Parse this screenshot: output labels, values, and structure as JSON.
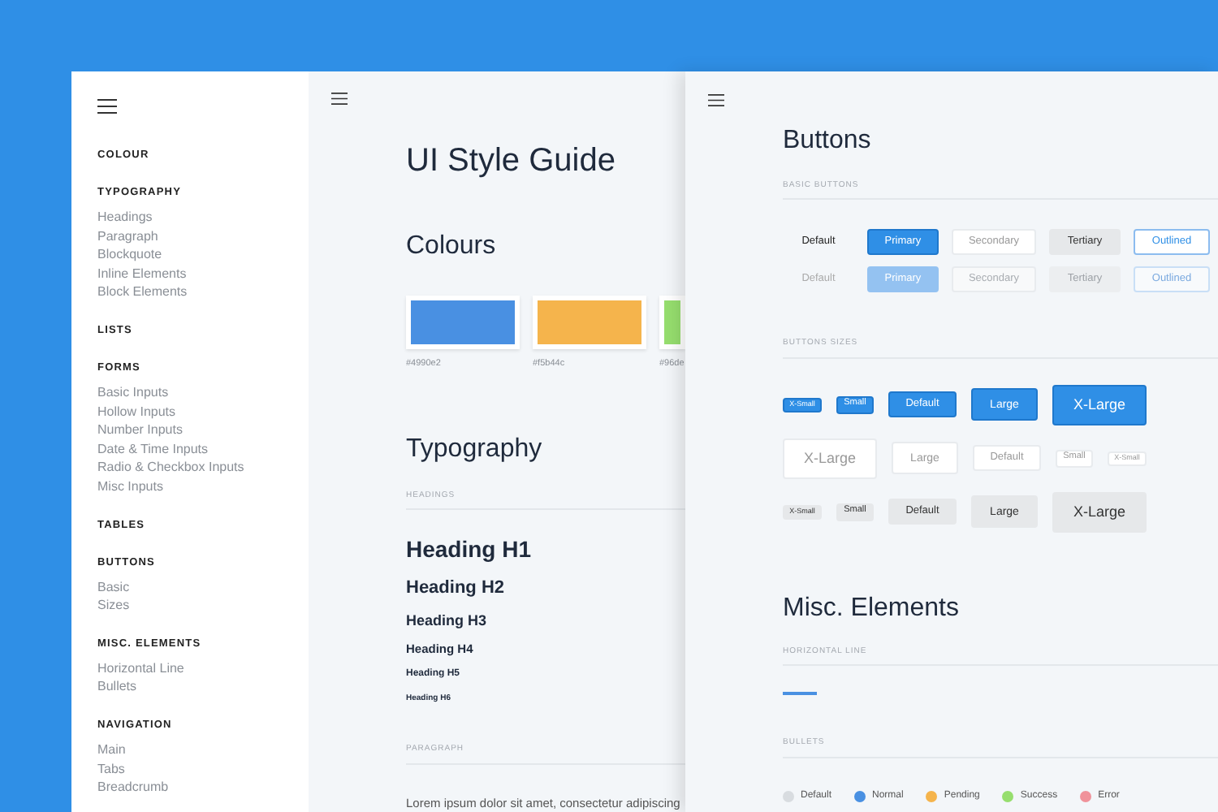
{
  "sidebar": {
    "sections": [
      {
        "title": "COLOUR"
      },
      {
        "title": "TYPOGRAPHY",
        "items": [
          "Headings",
          "Paragraph",
          "Blockquote",
          "Inline Elements",
          "Block Elements"
        ]
      },
      {
        "title": "LISTS"
      },
      {
        "title": "FORMS",
        "items": [
          "Basic Inputs",
          "Hollow Inputs",
          "Number Inputs",
          "Date & Time Inputs",
          "Radio & Checkbox Inputs",
          "Misc Inputs"
        ]
      },
      {
        "title": "TABLES"
      },
      {
        "title": "BUTTONS",
        "items": [
          "Basic",
          "Sizes"
        ]
      },
      {
        "title": "MISC. ELEMENTS",
        "items": [
          "Horizontal Line",
          "Bullets"
        ]
      },
      {
        "title": "NAVIGATION",
        "items": [
          "Main",
          "Tabs",
          "Breadcrumb"
        ]
      }
    ]
  },
  "guide": {
    "title": "UI Style Guide",
    "colours": {
      "heading": "Colours",
      "swatches": [
        {
          "color": "#4990e2",
          "label": "#4990e2"
        },
        {
          "color": "#f5b44c",
          "label": "#f5b44c"
        },
        {
          "color": "#96de6e",
          "label": "#96de"
        }
      ]
    },
    "typography": {
      "heading": "Typography",
      "headings_label": "HEADINGS",
      "headings": [
        {
          "kind": "h1",
          "text": "Heading H1"
        },
        {
          "kind": "h2",
          "text": "Heading H2"
        },
        {
          "kind": "h3",
          "text": "Heading H3"
        },
        {
          "kind": "h4",
          "text": "Heading H4"
        },
        {
          "kind": "h5",
          "text": "Heading H5"
        },
        {
          "kind": "h6",
          "text": "Heading H6"
        }
      ],
      "paragraph_label": "PARAGRAPH",
      "paragraph": "Lorem ipsum dolor sit amet, consectetur adipiscing"
    }
  },
  "buttons_page": {
    "title": "Buttons",
    "basic_label": "BASIC BUTTONS",
    "basic_rows": [
      {
        "disabled": false,
        "buttons": [
          {
            "kind": "default",
            "label": "Default"
          },
          {
            "kind": "primary",
            "label": "Primary"
          },
          {
            "kind": "secondary",
            "label": "Secondary"
          },
          {
            "kind": "tertiary",
            "label": "Tertiary"
          },
          {
            "kind": "outlined",
            "label": "Outlined"
          }
        ]
      },
      {
        "disabled": true,
        "buttons": [
          {
            "kind": "default",
            "label": "Default"
          },
          {
            "kind": "primary",
            "label": "Primary"
          },
          {
            "kind": "secondary",
            "label": "Secondary"
          },
          {
            "kind": "tertiary",
            "label": "Tertiary"
          },
          {
            "kind": "outlined",
            "label": "Outlined"
          }
        ]
      }
    ],
    "sizes_label": "BUTTONS SIZES",
    "size_rows": [
      {
        "kind": "primary",
        "buttons": [
          {
            "kind": "xs",
            "label": "X-Small"
          },
          {
            "kind": "s",
            "label": "Small"
          },
          {
            "kind": "m",
            "label": "Default"
          },
          {
            "kind": "l",
            "label": "Large"
          },
          {
            "kind": "xl",
            "label": "X-Large"
          }
        ]
      },
      {
        "kind": "secondary",
        "buttons": [
          {
            "kind": "xl",
            "label": "X-Large"
          },
          {
            "kind": "l",
            "label": "Large"
          },
          {
            "kind": "m",
            "label": "Default"
          },
          {
            "kind": "s",
            "label": "Small"
          },
          {
            "kind": "xs",
            "label": "X-Small"
          }
        ]
      },
      {
        "kind": "tertiary",
        "buttons": [
          {
            "kind": "xs",
            "label": "X-Small"
          },
          {
            "kind": "s",
            "label": "Small"
          },
          {
            "kind": "m",
            "label": "Default"
          },
          {
            "kind": "l",
            "label": "Large"
          },
          {
            "kind": "xl",
            "label": "X-Large"
          }
        ]
      }
    ],
    "misc": {
      "title": "Misc. Elements",
      "hr_label": "HORIZONTAL LINE",
      "bullets_label": "BULLETS",
      "bullets": [
        {
          "label": "Default",
          "color": "#d8dce0"
        },
        {
          "label": "Normal",
          "color": "#4990e2"
        },
        {
          "label": "Pending",
          "color": "#f5b44c"
        },
        {
          "label": "Success",
          "color": "#96de6e"
        },
        {
          "label": "Error",
          "color": "#f0929a"
        }
      ]
    }
  }
}
